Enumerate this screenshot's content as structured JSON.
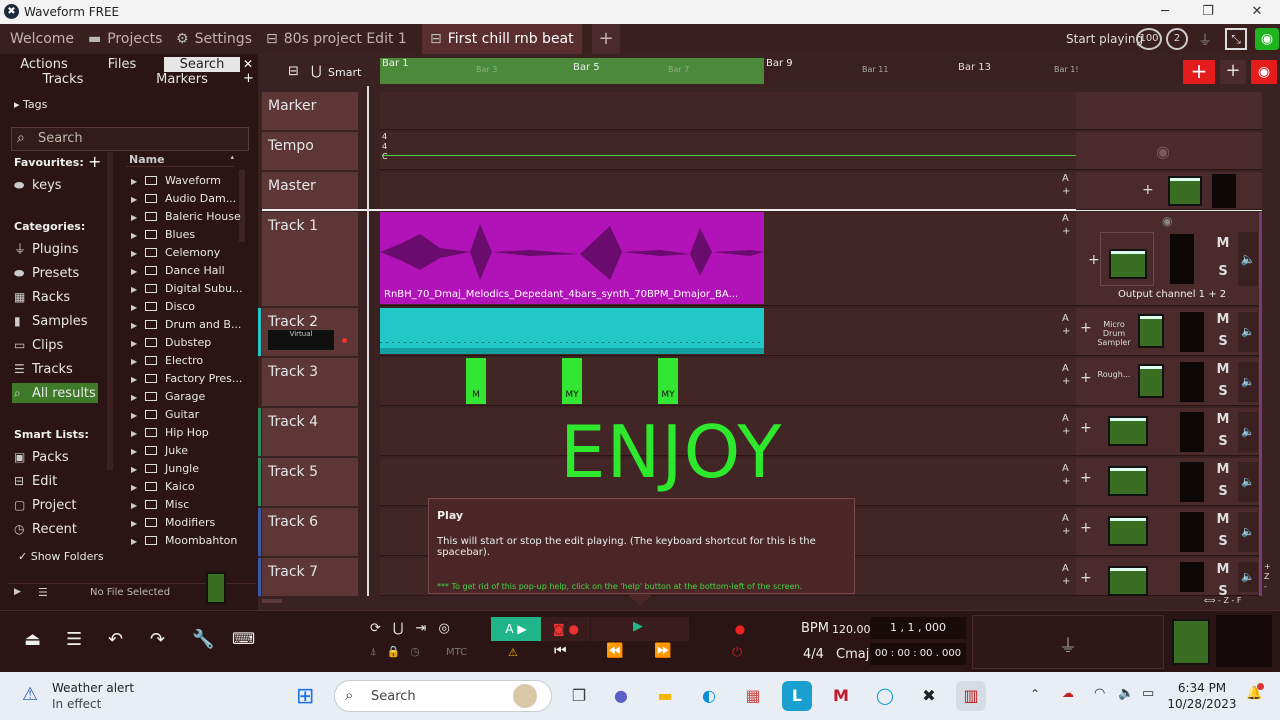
{
  "window": {
    "title": "Waveform FREE",
    "app_icon": "waveform-logo",
    "min": "─",
    "max": "❐",
    "close": "✕"
  },
  "tabs": [
    {
      "label": "Welcome"
    },
    {
      "label": "Projects",
      "icon": "folder-icon"
    },
    {
      "label": "Settings",
      "icon": "gear-icon"
    },
    {
      "label": "80s project Edit 1",
      "icon": "edit-icon"
    },
    {
      "label": "First chill rnb beat",
      "icon": "edit-icon",
      "active": true
    },
    {
      "label": "+"
    }
  ],
  "top_right": {
    "status": "Start playing",
    "cpu": "100",
    "two": "2"
  },
  "browser": {
    "tabs": [
      "Actions",
      "Files",
      "Search",
      "Tracks",
      "Markers"
    ],
    "selected_tab": "Search",
    "tags_label": "Tags",
    "search_placeholder": "Search",
    "favourites_label": "Favourites:",
    "favourites": [
      "keys"
    ],
    "categories_label": "Categories:",
    "categories": [
      "Plugins",
      "Presets",
      "Racks",
      "Samples",
      "Clips",
      "Tracks",
      "All results"
    ],
    "smart_lists_label": "Smart Lists:",
    "smart_lists": [
      "Packs",
      "Edit",
      "Project",
      "Recent"
    ],
    "show_folders": "Show Folders",
    "name_header": "Name",
    "folders": [
      "Waveform",
      "Audio Dam...",
      "Baleric House",
      "Blues",
      "Celemony",
      "Dance Hall",
      "Digital Subu...",
      "Disco",
      "Drum and B...",
      "Dubstep",
      "Electro",
      "Factory Pres...",
      "Garage",
      "Guitar",
      "Hip Hop",
      "Juke",
      "Jungle",
      "Kaico",
      "Misc",
      "Modifiers",
      "Moombahton"
    ],
    "no_file": "No File Selected"
  },
  "timeline": {
    "smart_label": "Smart",
    "bars": [
      "Bar 1",
      "Bar 3",
      "Bar 5",
      "Bar 7",
      "Bar 9",
      "Bar 11",
      "Bar 13",
      "Bar 1!"
    ],
    "tempo_sig": [
      "4",
      "4",
      "C"
    ]
  },
  "tracks": [
    {
      "name": "Marker"
    },
    {
      "name": "Tempo"
    },
    {
      "name": "Master"
    },
    {
      "name": "Track 1",
      "clip": "RnBH_70_Dmaj_Melodics_Depedant_4bars_synth_70BPM_Dmajor_BA...",
      "output": "Output channel 1 + 2"
    },
    {
      "name": "Track 2",
      "instrument": "Virtual",
      "plugin": "Micro Drum Sampler"
    },
    {
      "name": "Track 3",
      "plugin": "Rough...",
      "midi_clips": [
        "M",
        "MY",
        "MY"
      ]
    },
    {
      "name": "Track 4"
    },
    {
      "name": "Track 5"
    },
    {
      "name": "Track 6"
    },
    {
      "name": "Track 7"
    }
  ],
  "mute": "M",
  "solo": "S",
  "auto": "A",
  "overlay_text": "ENJOY",
  "popup": {
    "title": "Play",
    "body": "This will start or stop the edit playing. (The keyboard shortcut for this is the spacebar).",
    "hint": "*** To get rid of this pop-up help, click on the 'help' button at the bottom-left of the screen."
  },
  "transport": {
    "bpm_label": "BPM",
    "bpm": "120.00",
    "position": "1 , 1 , 000",
    "sig": "4/4",
    "key": "Cmaj",
    "time": "00 : 00 : 00 . 000",
    "mtc": "MTC"
  },
  "taskbar": {
    "weather_title": "Weather alert",
    "weather_sub": "In effect",
    "search": "Search",
    "time": "6:34 PM",
    "date": "10/28/2023"
  },
  "colors": {
    "track1": "#b213b8",
    "track2": "#22c8c8",
    "track3": "#34e634",
    "enjoy": "#2ee82e",
    "ruler": "#4a8a3a"
  }
}
